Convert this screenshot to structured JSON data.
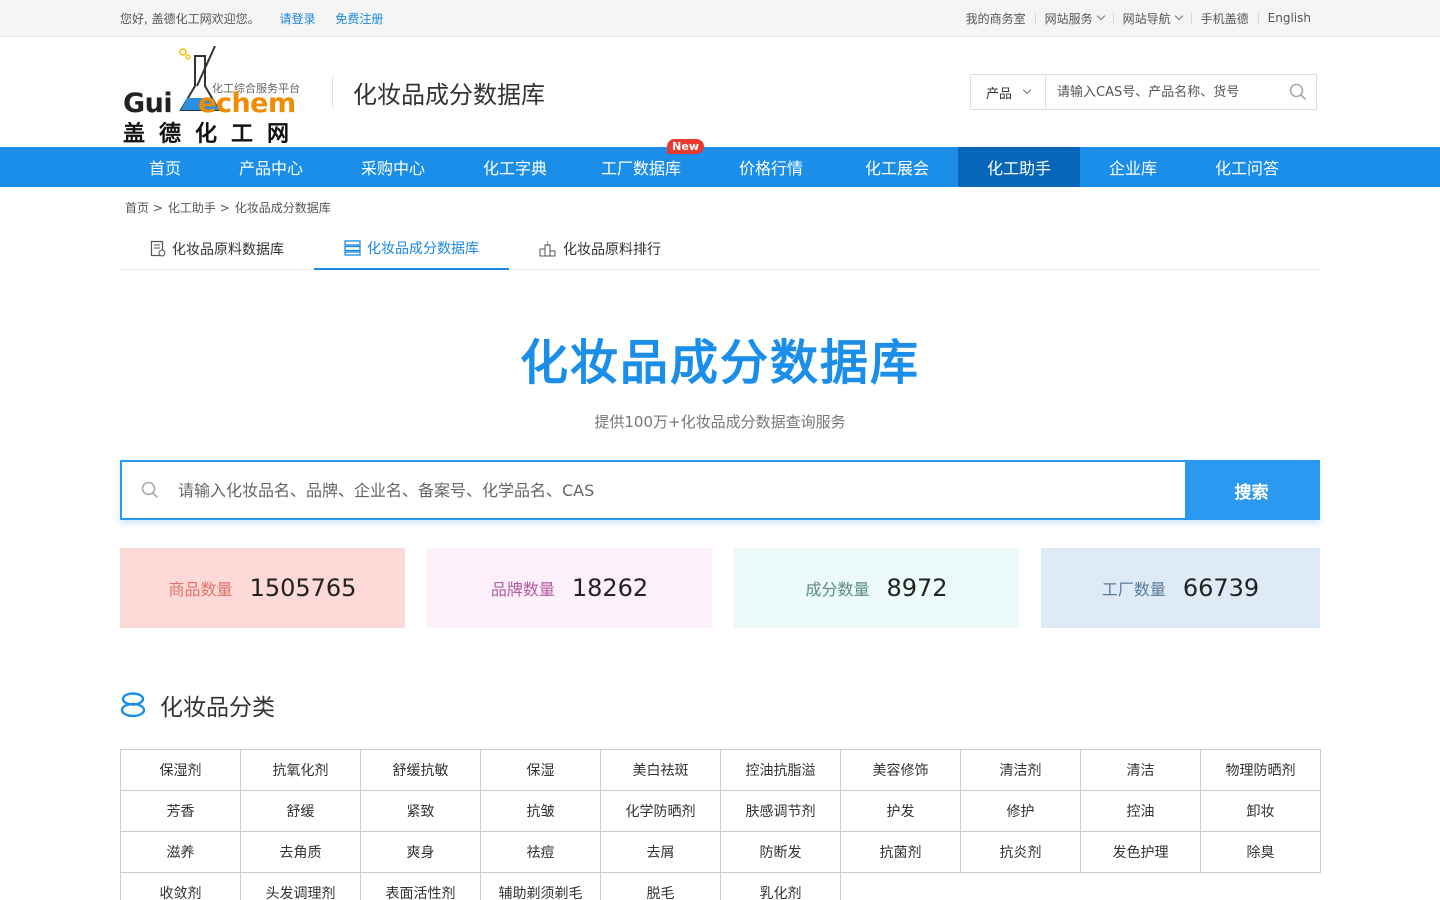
{
  "topbar": {
    "welcome": "您好, 盖德化工网欢迎您。",
    "login": "请登录",
    "register": "免费注册",
    "links": [
      {
        "label": "我的商务室",
        "dropdown": false
      },
      {
        "label": "网站服务",
        "dropdown": true
      },
      {
        "label": "网站导航",
        "dropdown": true
      },
      {
        "label": "手机盖德",
        "dropdown": false
      },
      {
        "label": "English",
        "dropdown": false
      }
    ]
  },
  "header": {
    "logo_slogan": "化工综合服务平台",
    "logo_en_a": "Gui",
    "logo_en_b": "echem",
    "logo_cn": "盖德化工网",
    "site_title": "化妆品成分数据库",
    "search_select": "产品",
    "search_placeholder": "请输入CAS号、产品名称、货号"
  },
  "nav": {
    "items": [
      {
        "label": "首页",
        "active": false
      },
      {
        "label": "产品中心",
        "active": false
      },
      {
        "label": "采购中心",
        "active": false
      },
      {
        "label": "化工字典",
        "active": false
      },
      {
        "label": "工厂数据库",
        "active": false,
        "badge": "New"
      },
      {
        "label": "价格行情",
        "active": false
      },
      {
        "label": "化工展会",
        "active": false
      },
      {
        "label": "化工助手",
        "active": true
      },
      {
        "label": "企业库",
        "active": false
      },
      {
        "label": "化工问答",
        "active": false
      }
    ]
  },
  "breadcrumb": [
    "首页 >",
    "化工助手 >",
    "化妆品成分数据库"
  ],
  "subtabs": [
    {
      "label": "化妆品原料数据库",
      "icon": "document-icon",
      "active": false
    },
    {
      "label": "化妆品成分数据库",
      "icon": "list-icon",
      "active": true
    },
    {
      "label": "化妆品原料排行",
      "icon": "ranking-icon",
      "active": false
    }
  ],
  "hero": {
    "title": "化妆品成分数据库",
    "subtitle": "提供100万+化妆品成分数据查询服务",
    "search_placeholder": "请输入化妆品名、品牌、企业名、备案号、化学品名、CAS",
    "search_button": "搜索"
  },
  "stats": [
    {
      "label": "商品数量",
      "value": "1505765",
      "bg": "#fdd9d7",
      "color": "#e2726a"
    },
    {
      "label": "品牌数量",
      "value": "18262",
      "bg": "#fdf0fa",
      "color": "#b35ca2"
    },
    {
      "label": "成分数量",
      "value": "8972",
      "bg": "#ecfbf9",
      "color": "#5a8c84"
    },
    {
      "label": "工厂数量",
      "value": "66739",
      "bg": "#deebf7",
      "color": "#5a7a99"
    }
  ],
  "categories": {
    "title": "化妆品分类",
    "items": [
      "保湿剂",
      "抗氧化剂",
      "舒缓抗敏",
      "保湿",
      "美白祛斑",
      "控油抗脂溢",
      "美容修饰",
      "清洁剂",
      "清洁",
      "物理防晒剂",
      "芳香",
      "舒缓",
      "紧致",
      "抗皱",
      "化学防晒剂",
      "肤感调节剂",
      "护发",
      "修护",
      "控油",
      "卸妆",
      "滋养",
      "去角质",
      "爽身",
      "祛痘",
      "去屑",
      "防断发",
      "抗菌剂",
      "抗炎剂",
      "发色护理",
      "除臭",
      "收敛剂",
      "头发调理剂",
      "表面活性剂",
      "辅助剃须剃毛",
      "脱毛",
      "乳化剂"
    ]
  },
  "colors": {
    "brand_blue": "#1a8ee8",
    "nav_active": "#0866b8",
    "accent_orange": "#f08c00"
  }
}
